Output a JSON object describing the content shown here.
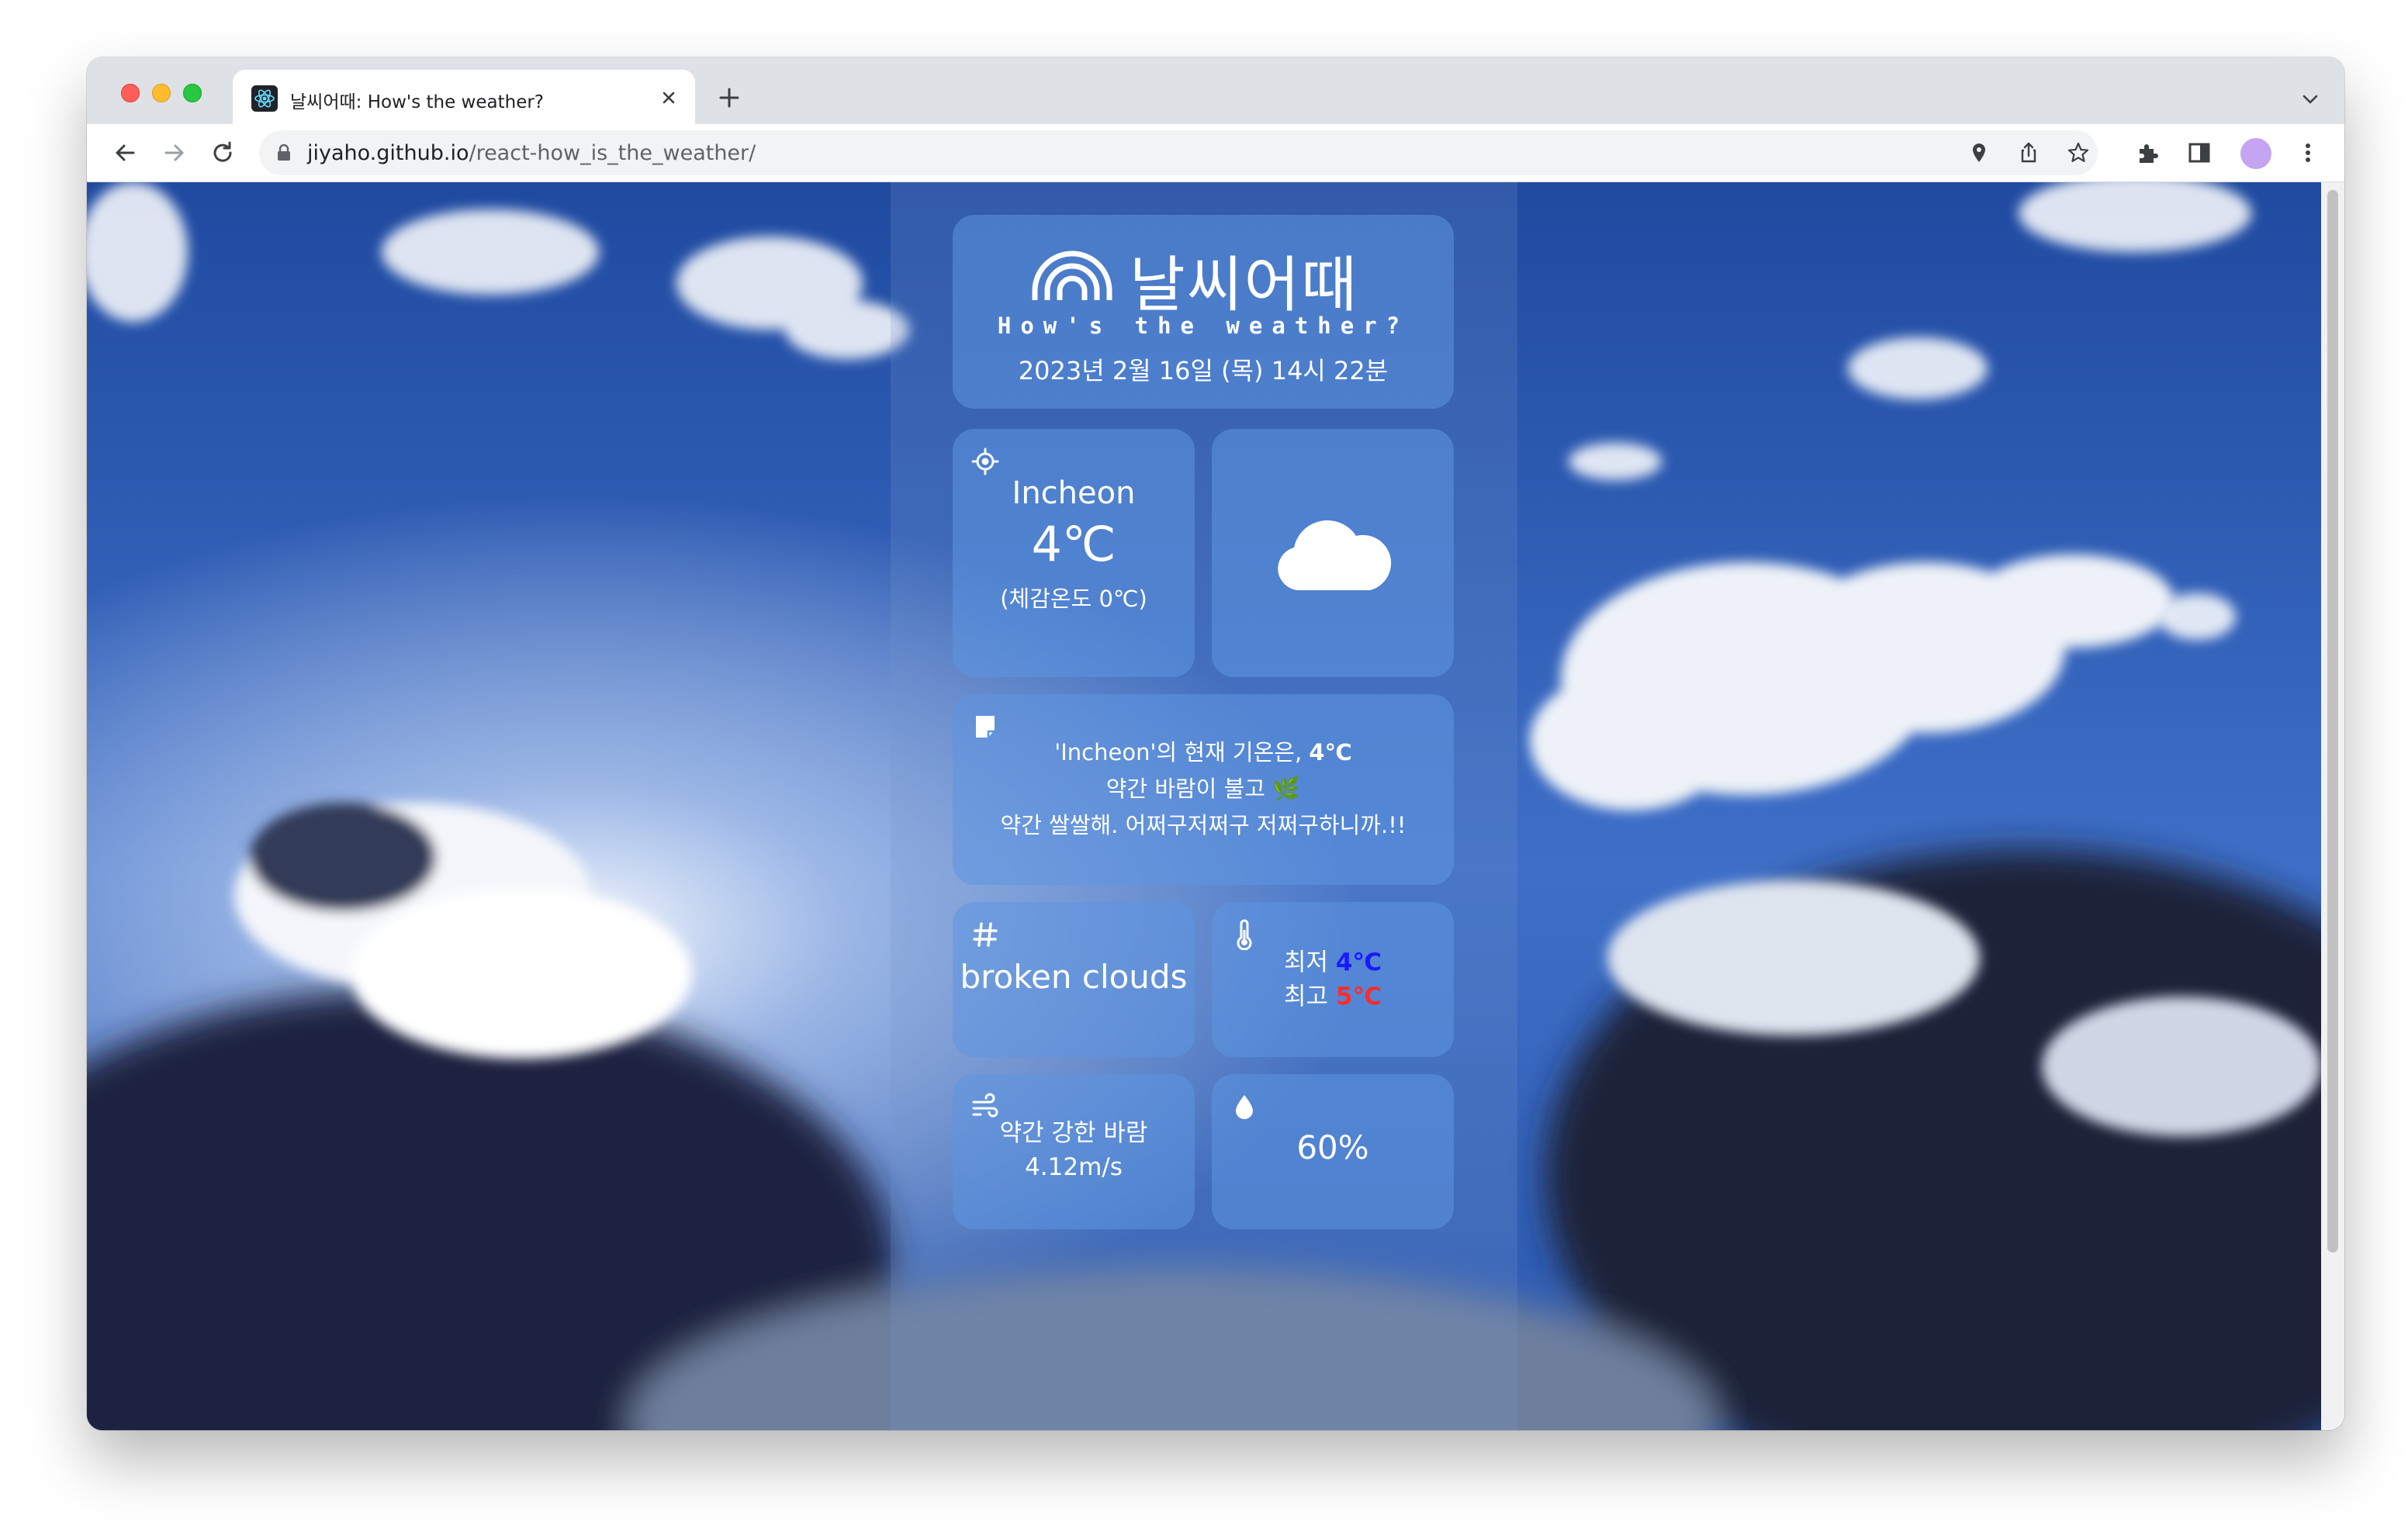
{
  "browser": {
    "tab_title": "날씨어때: How's the weather?",
    "url_host": "jiyaho.github.io",
    "url_path": "/react-how_is_the_weather/"
  },
  "app": {
    "title": "날씨어때",
    "subtitle": "How's the weather?",
    "date": "2023년 2월 16일 (목) 14시 22분"
  },
  "location": {
    "city": "Incheon",
    "temp": "4℃",
    "feels_like": "(체감온도 0℃)"
  },
  "weather_icon": "cloud-icon",
  "message": {
    "line1_pre": "'Incheon'의 현재 기온은, ",
    "line1_temp": "4℃",
    "line2": "약간 바람이 불고 🌿",
    "line3": "약간 쌀쌀해. 어쩌구저쩌구 저쩌구하니까.!!"
  },
  "description": "broken clouds",
  "minmax": {
    "min_label": "최저 ",
    "min_value": "4℃",
    "max_label": "최고 ",
    "max_value": "5℃",
    "min_color": "#1a1aff",
    "max_color": "#ff2b2b"
  },
  "wind": {
    "label": "약간 강한 바람",
    "speed": "4.12m/s"
  },
  "humidity": "60%"
}
